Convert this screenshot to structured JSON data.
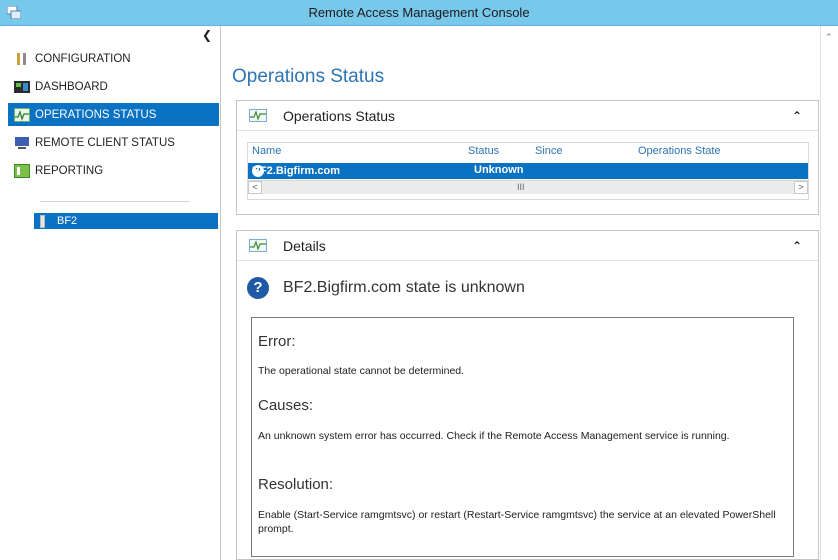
{
  "window": {
    "title": "Remote Access Management Console"
  },
  "nav": {
    "items": [
      {
        "label": "CONFIGURATION",
        "icon": "wrench-icon",
        "active": false
      },
      {
        "label": "DASHBOARD",
        "icon": "dashboard-icon",
        "active": false
      },
      {
        "label": "OPERATIONS STATUS",
        "icon": "monitor-graph-icon",
        "active": true
      },
      {
        "label": "REMOTE CLIENT STATUS",
        "icon": "computer-icon",
        "active": false
      },
      {
        "label": "REPORTING",
        "icon": "report-icon",
        "active": false
      }
    ],
    "server": {
      "label": "BF2",
      "icon": "server-icon"
    }
  },
  "main": {
    "page_title": "Operations Status",
    "ops_panel": {
      "title": "Operations Status",
      "columns": [
        "Name",
        "Status",
        "Since",
        "Operations State"
      ],
      "rows": [
        {
          "name": "BF2.Bigfirm.com",
          "status": "Unknown",
          "since": "",
          "state": ""
        }
      ],
      "scroll_grip": "III"
    },
    "details_panel": {
      "title": "Details",
      "state_text": "BF2.Bigfirm.com state is unknown",
      "error_heading": "Error:",
      "error_text": "The operational state cannot be determined.",
      "causes_heading": "Causes:",
      "causes_text": "An unknown system error has occurred. Check if the Remote Access Management service is running.",
      "resolution_heading": "Resolution:",
      "resolution_text": "Enable (Start-Service ramgmtsvc) or restart (Restart-Service ramgmtsvc) the service at an elevated PowerShell prompt."
    }
  },
  "colors": {
    "accent": "#0a72c3",
    "titlebar": "#78c8ec",
    "heading": "#2e74b5"
  }
}
